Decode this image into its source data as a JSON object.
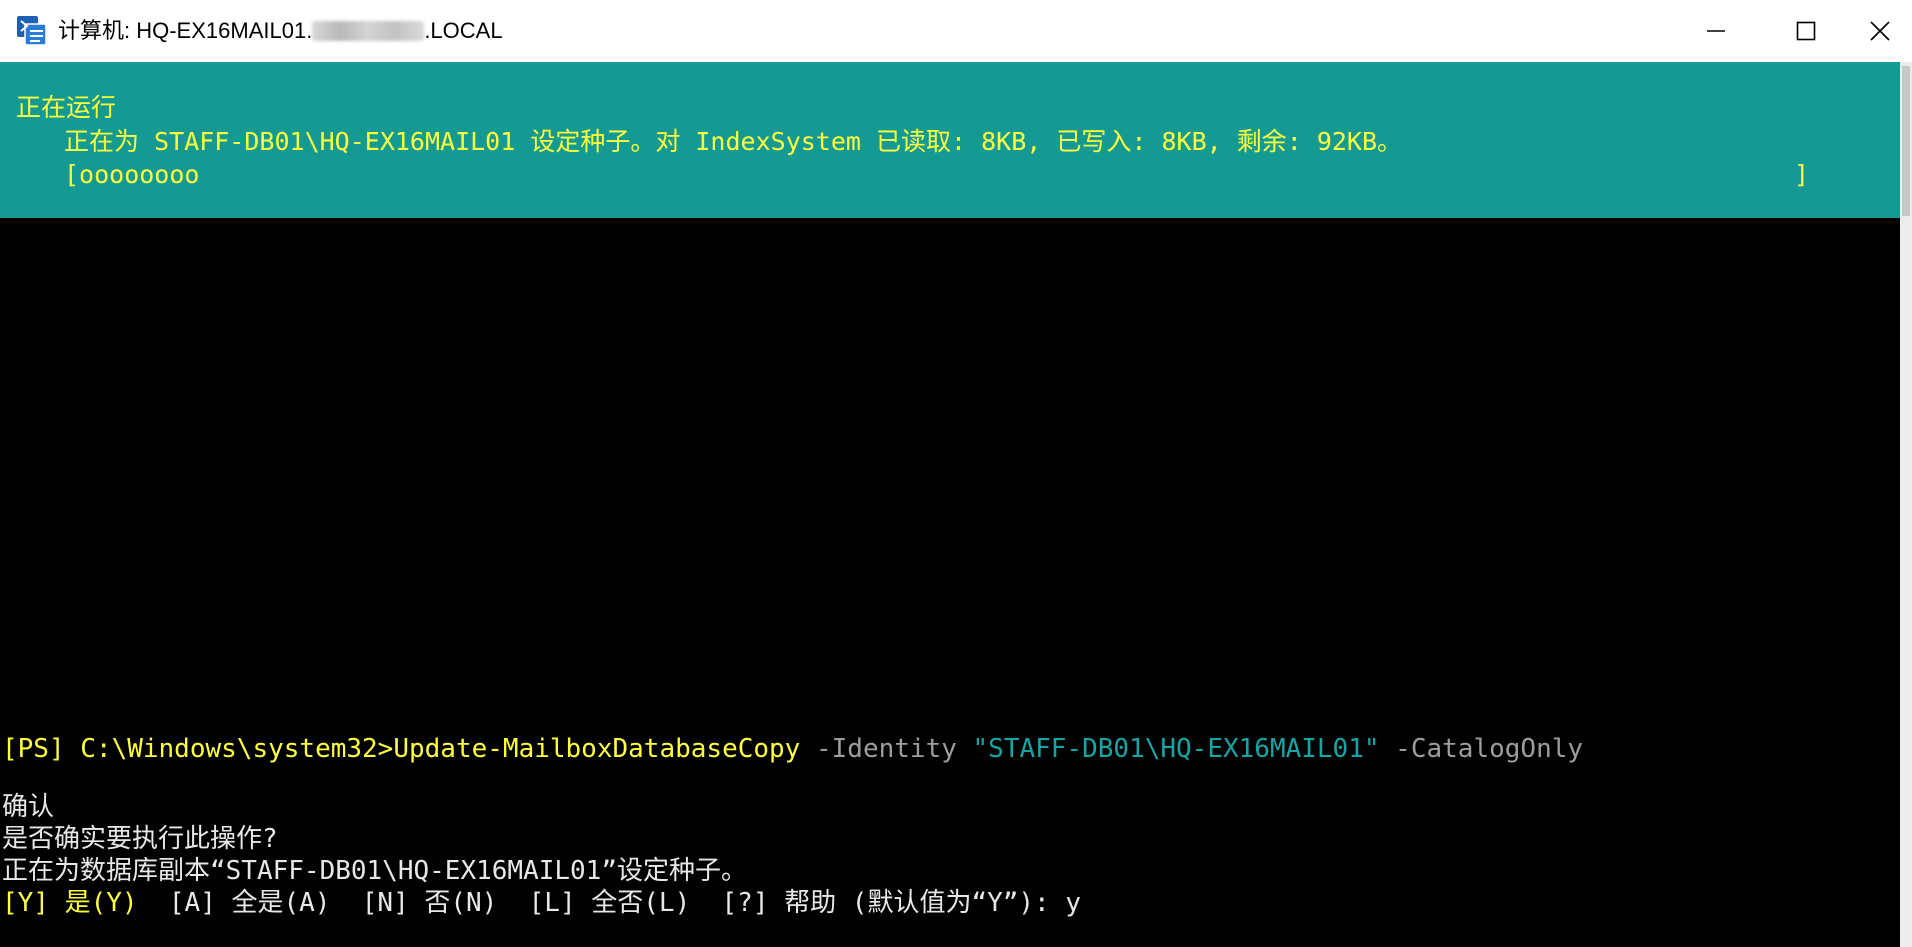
{
  "window": {
    "title_prefix": "计算机: HQ-EX16MAIL01.",
    "title_suffix": ".LOCAL",
    "buttons": {
      "minimize": "minimize",
      "maximize": "maximize",
      "close": "close"
    }
  },
  "progress": {
    "activity": "正在运行",
    "status": "正在为 STAFF-DB01\\HQ-EX16MAIL01 设定种子。对 IndexSystem 已读取: 8KB, 已写入: 8KB, 剩余: 92KB。",
    "bar": "[oooooooo",
    "bar_end": "]"
  },
  "console": {
    "prompt": "[PS] C:\\Windows\\system32>",
    "cmdlet": "Update-MailboxDatabaseCopy",
    "param1": " -Identity ",
    "param1_value": "\"STAFF-DB01\\HQ-EX16MAIL01\"",
    "param2": " -CatalogOnly",
    "confirm_title": "确认",
    "confirm_question": "是否确实要执行此操作?",
    "confirm_detail": "正在为数据库副本“STAFF-DB01\\HQ-EX16MAIL01”设定种子。",
    "choice_yes": "[Y] 是(Y)",
    "choice_rest": "  [A] 全是(A)  [N] 否(N)  [L] 全否(L)  [?] 帮助 (默认值为“Y”): y"
  },
  "colors": {
    "progress_bg": "#149a93",
    "progress_fg": "#ffff3d",
    "console_bg": "#000000",
    "string_literal": "#16a4a4",
    "parameter": "#9d9d9d"
  },
  "icons": [
    "powershell-app-icon",
    "minimize-icon",
    "maximize-icon",
    "close-icon"
  ]
}
